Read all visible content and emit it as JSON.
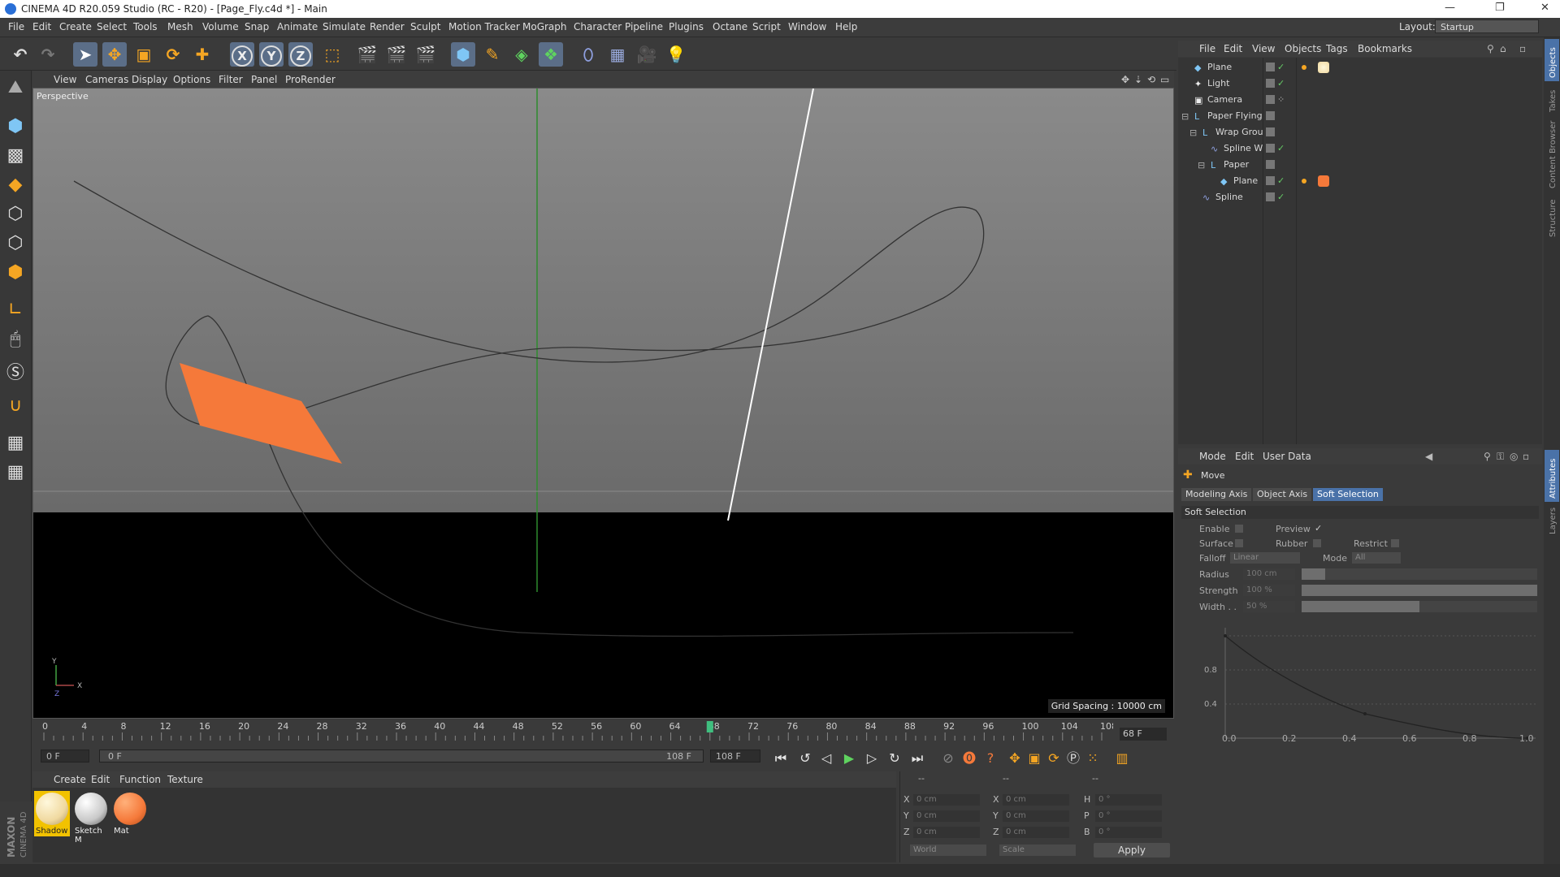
{
  "window": {
    "title": "CINEMA 4D R20.059 Studio (RC - R20) - [Page_Fly.c4d *] - Main",
    "controls": [
      "—",
      "❐",
      "✕"
    ]
  },
  "menubar": {
    "items": [
      "File",
      "Edit",
      "Create",
      "Select",
      "Tools",
      "Mesh",
      "Volume",
      "Snap",
      "Animate",
      "Simulate",
      "Render",
      "Sculpt",
      "Motion Tracker",
      "MoGraph",
      "Character",
      "Pipeline",
      "Plugins",
      "Octane",
      "Script",
      "Window",
      "Help"
    ],
    "layout_label": "Layout:",
    "layout_value": "Startup"
  },
  "toolbar": {
    "axis_x": "X",
    "axis_y": "Y",
    "axis_z": "Z"
  },
  "viewport": {
    "menu": [
      "View",
      "Cameras",
      "Display",
      "Options",
      "Filter",
      "Panel",
      "ProRender"
    ],
    "label": "Perspective",
    "grid_spacing": "Grid Spacing : 10000 cm",
    "axis_labels": {
      "y": "Y",
      "x": "X",
      "z": "Z"
    },
    "plane_color": "#f5793a"
  },
  "timeline": {
    "ticks": [
      "0",
      "4",
      "8",
      "12",
      "16",
      "20",
      "24",
      "28",
      "32",
      "36",
      "40",
      "44",
      "48",
      "52",
      "56",
      "60",
      "64",
      "68",
      "72",
      "76",
      "80",
      "84",
      "88",
      "92",
      "96",
      "100",
      "104",
      "108"
    ],
    "current_frame": 68,
    "end_frame_field": "68 F",
    "start_field": "0 F",
    "range_start": "0 F",
    "range_end": "108 F",
    "max_field": "108 F"
  },
  "materials": {
    "menu": [
      "Create",
      "Edit",
      "Function",
      "Texture"
    ],
    "items": [
      {
        "label": "Shadow",
        "color": "#f0d9a0"
      },
      {
        "label": "Sketch M",
        "color": "#c8c8c8"
      },
      {
        "label": "Mat",
        "color": "#f5793a"
      }
    ]
  },
  "coords": {
    "header": [
      "--",
      "--",
      "--"
    ],
    "rows": [
      {
        "a": "X",
        "av": "0 cm",
        "b": "X",
        "bv": "0 cm",
        "c": "H",
        "cv": "0 °"
      },
      {
        "a": "Y",
        "av": "0 cm",
        "b": "Y",
        "bv": "0 cm",
        "c": "P",
        "cv": "0 °"
      },
      {
        "a": "Z",
        "av": "0 cm",
        "b": "Z",
        "bv": "0 cm",
        "c": "B",
        "cv": "0 °"
      }
    ],
    "world": "World",
    "scale": "Scale",
    "apply": "Apply"
  },
  "object_manager": {
    "menu": [
      "File",
      "Edit",
      "View",
      "Objects",
      "Tags",
      "Bookmarks"
    ],
    "objects": [
      {
        "name": "Plane",
        "indent": 0
      },
      {
        "name": "Light",
        "indent": 0
      },
      {
        "name": "Camera",
        "indent": 0
      },
      {
        "name": "Paper Flying",
        "indent": 0
      },
      {
        "name": "Wrap Grou",
        "indent": 1
      },
      {
        "name": "Spline W",
        "indent": 2
      },
      {
        "name": "Paper",
        "indent": 1
      },
      {
        "name": "Plane",
        "indent": 2
      },
      {
        "name": "Spline",
        "indent": 1
      }
    ]
  },
  "attributes": {
    "menu": [
      "Mode",
      "Edit",
      "User Data"
    ],
    "tool": "Move",
    "tabs": [
      "Modeling Axis",
      "Object Axis",
      "Soft Selection"
    ],
    "section": "Soft Selection",
    "enable": "Enable",
    "preview": "Preview",
    "surface": "Surface",
    "rubber": "Rubber",
    "restrict": "Restrict",
    "falloff": "Falloff",
    "falloff_value": "Linear",
    "mode": "Mode",
    "mode_value": "All",
    "radius": "Radius",
    "radius_value": "100 cm",
    "strength": "Strength",
    "strength_value": "100 %",
    "width": "Width . .",
    "width_value": "50 %",
    "graph_y_ticks": [
      "0.8",
      "0.4"
    ],
    "graph_x_ticks": [
      "0.0",
      "0.2",
      "0.4",
      "0.6",
      "0.8",
      "1.0"
    ]
  },
  "side_tabs": [
    "Objects",
    "Takes",
    "Content Browser",
    "Structure",
    "Attributes",
    "Layers"
  ]
}
